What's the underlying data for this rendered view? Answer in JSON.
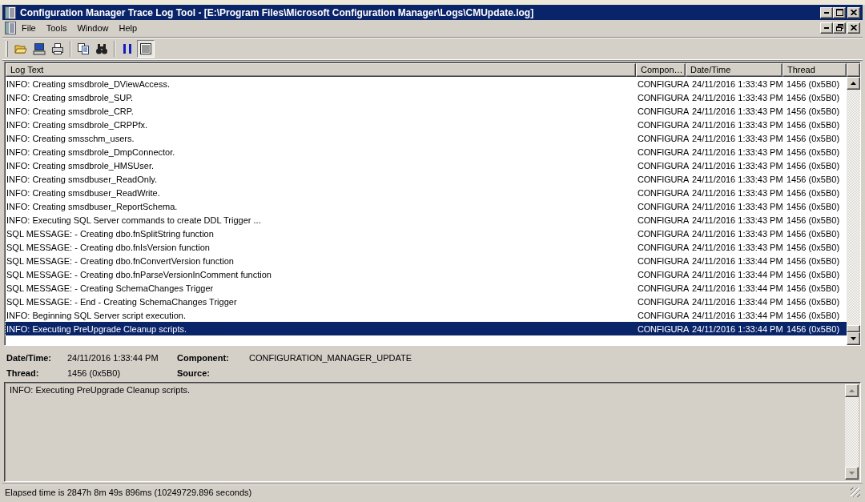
{
  "window": {
    "title": "Configuration Manager Trace Log Tool - [E:\\Program Files\\Microsoft Configuration Manager\\Logs\\CMUpdate.log]"
  },
  "menu": [
    "File",
    "Tools",
    "Window",
    "Help"
  ],
  "toolbar": [
    {
      "kind": "open",
      "pressed": false
    },
    {
      "kind": "computer",
      "pressed": false
    },
    {
      "kind": "print",
      "pressed": false
    },
    {
      "kind": "copy",
      "pressed": false
    },
    {
      "kind": "find",
      "pressed": false
    },
    {
      "kind": "pause",
      "pressed": false
    },
    {
      "kind": "highlight",
      "pressed": true
    }
  ],
  "table": {
    "columns": [
      "Log Text",
      "Compon…",
      "Date/Time",
      "Thread"
    ],
    "rows": [
      {
        "text": "INFO: Creating smsdbrole_DViewAccess.",
        "component": "CONFIGURA",
        "datetime": "24/11/2016 1:33:43 PM",
        "thread": "1456 (0x5B0)",
        "selected": false
      },
      {
        "text": "INFO: Creating smsdbrole_SUP.",
        "component": "CONFIGURA",
        "datetime": "24/11/2016 1:33:43 PM",
        "thread": "1456 (0x5B0)",
        "selected": false
      },
      {
        "text": "INFO: Creating smsdbrole_CRP.",
        "component": "CONFIGURA",
        "datetime": "24/11/2016 1:33:43 PM",
        "thread": "1456 (0x5B0)",
        "selected": false
      },
      {
        "text": "INFO: Creating smsdbrole_CRPPfx.",
        "component": "CONFIGURA",
        "datetime": "24/11/2016 1:33:43 PM",
        "thread": "1456 (0x5B0)",
        "selected": false
      },
      {
        "text": "INFO: Creating smsschm_users.",
        "component": "CONFIGURA",
        "datetime": "24/11/2016 1:33:43 PM",
        "thread": "1456 (0x5B0)",
        "selected": false
      },
      {
        "text": "INFO: Creating smsdbrole_DmpConnector.",
        "component": "CONFIGURA",
        "datetime": "24/11/2016 1:33:43 PM",
        "thread": "1456 (0x5B0)",
        "selected": false
      },
      {
        "text": "INFO: Creating smsdbrole_HMSUser.",
        "component": "CONFIGURA",
        "datetime": "24/11/2016 1:33:43 PM",
        "thread": "1456 (0x5B0)",
        "selected": false
      },
      {
        "text": "INFO: Creating smsdbuser_ReadOnly.",
        "component": "CONFIGURA",
        "datetime": "24/11/2016 1:33:43 PM",
        "thread": "1456 (0x5B0)",
        "selected": false
      },
      {
        "text": "INFO: Creating smsdbuser_ReadWrite.",
        "component": "CONFIGURA",
        "datetime": "24/11/2016 1:33:43 PM",
        "thread": "1456 (0x5B0)",
        "selected": false
      },
      {
        "text": "INFO: Creating smsdbuser_ReportSchema.",
        "component": "CONFIGURA",
        "datetime": "24/11/2016 1:33:43 PM",
        "thread": "1456 (0x5B0)",
        "selected": false
      },
      {
        "text": "INFO: Executing SQL Server commands to create DDL Trigger ...",
        "component": "CONFIGURA",
        "datetime": "24/11/2016 1:33:43 PM",
        "thread": "1456 (0x5B0)",
        "selected": false
      },
      {
        "text": "SQL MESSAGE:  - Creating dbo.fnSplitString function",
        "component": "CONFIGURA",
        "datetime": "24/11/2016 1:33:43 PM",
        "thread": "1456 (0x5B0)",
        "selected": false
      },
      {
        "text": "SQL MESSAGE:  - Creating dbo.fnIsVersion function",
        "component": "CONFIGURA",
        "datetime": "24/11/2016 1:33:43 PM",
        "thread": "1456 (0x5B0)",
        "selected": false
      },
      {
        "text": "SQL MESSAGE:  - Creating dbo.fnConvertVersion function",
        "component": "CONFIGURA",
        "datetime": "24/11/2016 1:33:44 PM",
        "thread": "1456 (0x5B0)",
        "selected": false
      },
      {
        "text": "SQL MESSAGE:  - Creating dbo.fnParseVersionInComment function",
        "component": "CONFIGURA",
        "datetime": "24/11/2016 1:33:44 PM",
        "thread": "1456 (0x5B0)",
        "selected": false
      },
      {
        "text": "SQL MESSAGE:  - Creating SchemaChanges Trigger",
        "component": "CONFIGURA",
        "datetime": "24/11/2016 1:33:44 PM",
        "thread": "1456 (0x5B0)",
        "selected": false
      },
      {
        "text": "SQL MESSAGE:  - End - Creating SchemaChanges Trigger",
        "component": "CONFIGURA",
        "datetime": "24/11/2016 1:33:44 PM",
        "thread": "1456 (0x5B0)",
        "selected": false
      },
      {
        "text": "INFO: Beginning SQL Server script execution.",
        "component": "CONFIGURA",
        "datetime": "24/11/2016 1:33:44 PM",
        "thread": "1456 (0x5B0)",
        "selected": false
      },
      {
        "text": "INFO: Executing PreUpgrade Cleanup scripts.",
        "component": "CONFIGURA",
        "datetime": "24/11/2016 1:33:44 PM",
        "thread": "1456 (0x5B0)",
        "selected": true
      }
    ]
  },
  "details": {
    "datetime_label": "Date/Time:",
    "datetime": "24/11/2016 1:33:44 PM",
    "component_label": "Component:",
    "component": "CONFIGURATION_MANAGER_UPDATE",
    "thread_label": "Thread:",
    "thread": "1456 (0x5B0)",
    "source_label": "Source:"
  },
  "message": "INFO: Executing PreUpgrade Cleanup scripts.",
  "status_bar": "Elapsed time is 2847h 8m 49s 896ms (10249729.896 seconds)"
}
